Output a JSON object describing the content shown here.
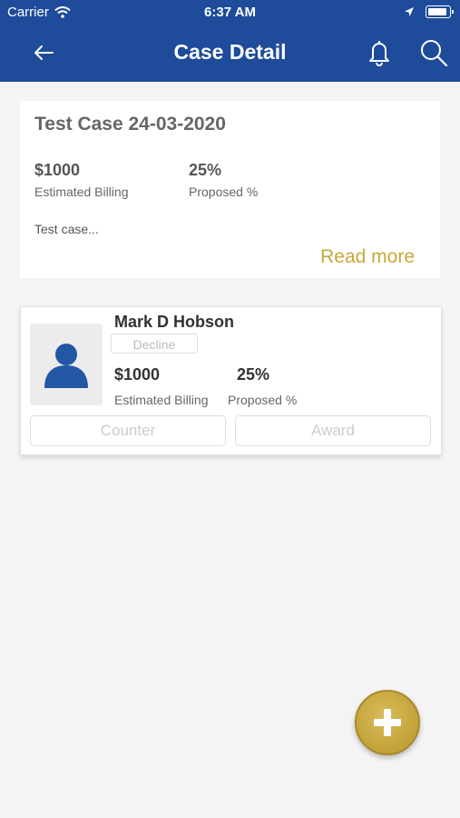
{
  "status_bar": {
    "carrier": "Carrier",
    "time": "6:37 AM"
  },
  "header": {
    "title": "Case Detail"
  },
  "case": {
    "title": "Test Case 24-03-2020",
    "billing_value": "$1000",
    "billing_label": "Estimated Billing",
    "proposed_value": "25%",
    "proposed_label": "Proposed %",
    "description": "Test case...",
    "read_more": "Read more"
  },
  "bid": {
    "name": "Mark D Hobson",
    "decline_label": "Decline",
    "billing_value": "$1000",
    "billing_label": "Estimated Billing",
    "proposed_value": "25%",
    "proposed_label": "Proposed %",
    "counter_label": "Counter",
    "award_label": "Award"
  },
  "colors": {
    "header_bg": "#1e4c9a",
    "accent_gold": "#c9a83a",
    "avatar_blue": "#2456a6"
  },
  "icons": [
    "back-arrow-icon",
    "bell-icon",
    "search-icon",
    "wifi-icon",
    "location-arrow-icon",
    "battery-icon",
    "person-icon",
    "plus-icon"
  ]
}
